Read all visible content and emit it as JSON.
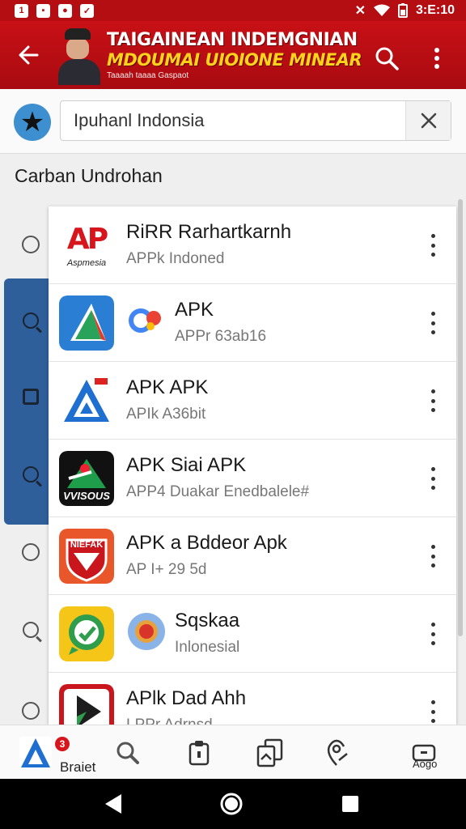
{
  "status_bar": {
    "left_icons": [
      "notification-icon-1",
      "notification-icon-2",
      "notification-icon-3",
      "notification-icon-4"
    ],
    "time": "3:E:10",
    "right_icons": [
      "mute-icon",
      "wifi-icon",
      "battery-icon"
    ]
  },
  "app_bar": {
    "title_line1": "TAIGAINEAN INDEMGNIAN",
    "title_line2": "MDOUMAI UIOIONE MINEAR",
    "title_line3": "Taaaah taaaa Gaspaot",
    "colors": {
      "background": "#b80d12",
      "title_line2": "#ffd21c"
    }
  },
  "search": {
    "query": "Ipuhanl Indonsia",
    "clear_icon": "close-icon"
  },
  "section_title": "Carban Undrohan",
  "apps": [
    {
      "icon_text": "AP",
      "icon_subtext": "Aspmesia",
      "name": "RiRR Rarhartkarnh",
      "subtitle": "APPk  Indoned"
    },
    {
      "name": "APK",
      "subtitle": "APPr  63ab16"
    },
    {
      "name": "APK APK",
      "subtitle": "APIk  A36bit"
    },
    {
      "icon_text": "VVISOUS",
      "name": "APK Siai APK",
      "subtitle": "APP4  Duakar Enedbalele#"
    },
    {
      "icon_text": "NIEFAK",
      "name": "APK a Bddeor Apk",
      "subtitle": "AP I+  29 5d"
    },
    {
      "name": "Sqskaa",
      "subtitle": "Inlonesial"
    },
    {
      "name": "APlk Dad Ahh",
      "subtitle": "LPPr  Adrnsd"
    }
  ],
  "bottom_nav": {
    "home_label": "Braiet",
    "home_badge": "3",
    "last_label": "Aogo"
  }
}
